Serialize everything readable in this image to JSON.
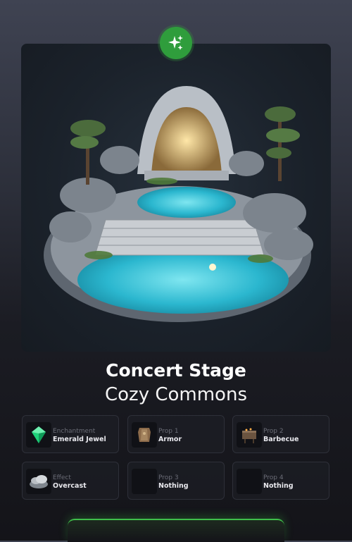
{
  "item": {
    "title": "Concert Stage",
    "subtitle": "Cozy Commons"
  },
  "badge": {
    "icon": "sparkles-icon",
    "color": "#2f9d3c"
  },
  "attributes": [
    {
      "label": "Enchantment",
      "value": "Emerald Jewel",
      "icon": "emerald-jewel-icon"
    },
    {
      "label": "Prop 1",
      "value": "Armor",
      "icon": "armor-icon"
    },
    {
      "label": "Prop 2",
      "value": "Barbecue",
      "icon": "barbecue-icon"
    },
    {
      "label": "Effect",
      "value": "Overcast",
      "icon": "overcast-icon"
    },
    {
      "label": "Prop 3",
      "value": "Nothing",
      "icon": "empty-icon"
    },
    {
      "label": "Prop 4",
      "value": "Nothing",
      "icon": "empty-icon"
    }
  ],
  "colors": {
    "accent": "#3fbf4a"
  }
}
